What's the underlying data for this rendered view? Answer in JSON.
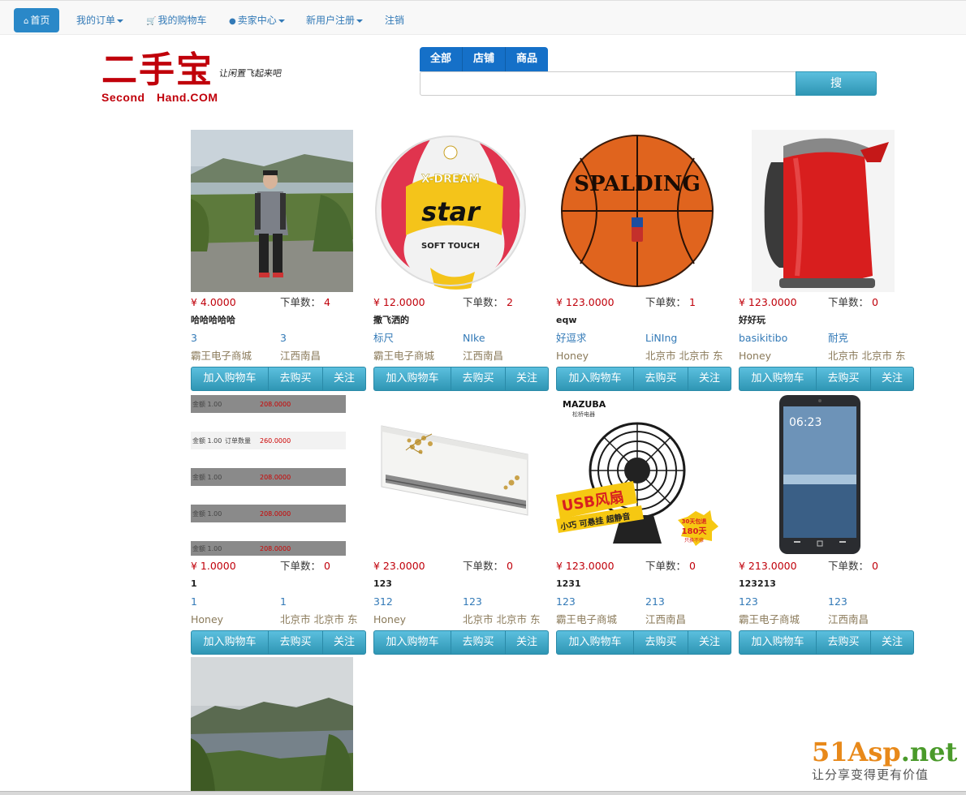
{
  "nav": {
    "home": "首页",
    "orders": "我的订单",
    "cart": "我的购物车",
    "seller": "卖家中心",
    "register": "新用户注册",
    "logout": "注销"
  },
  "logo": {
    "title": "二手宝",
    "slogan": "让闲置飞起来吧",
    "subtitle": "Second  Hand.COM"
  },
  "search": {
    "tabs": [
      "全部",
      "店铺",
      "商品"
    ],
    "value": "",
    "button": "搜"
  },
  "orders_label": "下单数：",
  "buttons": {
    "add_cart": "加入购物车",
    "buy": "去购买",
    "follow": "关注"
  },
  "products": [
    {
      "price": "¥ 4.0000",
      "orders": "4",
      "name": "哈哈哈哈哈",
      "c1": "3",
      "c2": "3",
      "shop": "霸王电子商城",
      "location": "江西南昌"
    },
    {
      "price": "¥ 12.0000",
      "orders": "2",
      "name": "撒飞洒的",
      "c1": "标尺",
      "c2": "NIke",
      "shop": "霸王电子商城",
      "location": "江西南昌"
    },
    {
      "price": "¥ 123.0000",
      "orders": "1",
      "name": "eqw",
      "c1": "好逗求",
      "c2": "LiNIng",
      "shop": "Honey",
      "location": "北京市 北京市 东"
    },
    {
      "price": "¥ 123.0000",
      "orders": "0",
      "name": "好好玩",
      "c1": "basikitibo",
      "c2": "耐克",
      "shop": "Honey",
      "location": "北京市 北京市 东"
    },
    {
      "price": "¥ 1.0000",
      "orders": "0",
      "name": "1",
      "c1": "1",
      "c2": "1",
      "shop": "Honey",
      "location": "北京市 北京市 东"
    },
    {
      "price": "¥ 23.0000",
      "orders": "0",
      "name": "123",
      "c1": "312",
      "c2": "123",
      "shop": "Honey",
      "location": "北京市 北京市 东"
    },
    {
      "price": "¥ 123.0000",
      "orders": "0",
      "name": "1231",
      "c1": "123",
      "c2": "213",
      "shop": "霸王电子商城",
      "location": "江西南昌"
    },
    {
      "price": "¥ 213.0000",
      "orders": "0",
      "name": "123213",
      "c1": "123",
      "c2": "123",
      "shop": "霸王电子商城",
      "location": "江西南昌"
    }
  ],
  "image_text": {
    "volleyball_brand": "star",
    "volleyball_top": "X-DREAM",
    "volleyball_sub": "SOFT TOUCH",
    "basketball_brand": "SPALDING",
    "fan_brand": "MAZUBA",
    "fan_brand_cn": "松桥电器",
    "fan_banner": "USB风扇",
    "fan_tagline": "小巧 可悬挂 超静音",
    "fan_badge": [
      "30天包退",
      "180天",
      "只换不修"
    ],
    "screenshot_rows": [
      {
        "left": "金额 1.00",
        "mid": "",
        "right": "208.0000"
      },
      {
        "left": "金额 1.00",
        "mid": "订单数量",
        "right": "260.0000"
      },
      {
        "left": "金额 1.00",
        "mid": "",
        "right": "208.0000"
      },
      {
        "left": "金额 1.00",
        "mid": "",
        "right": "208.0000"
      },
      {
        "left": "金额 1.00",
        "mid": "",
        "right": "208.0000"
      }
    ],
    "phone_time": "06:23"
  },
  "watermark": {
    "title_a": "51Asp",
    "title_b": ".net",
    "subtitle": "让分享变得更有价值"
  }
}
